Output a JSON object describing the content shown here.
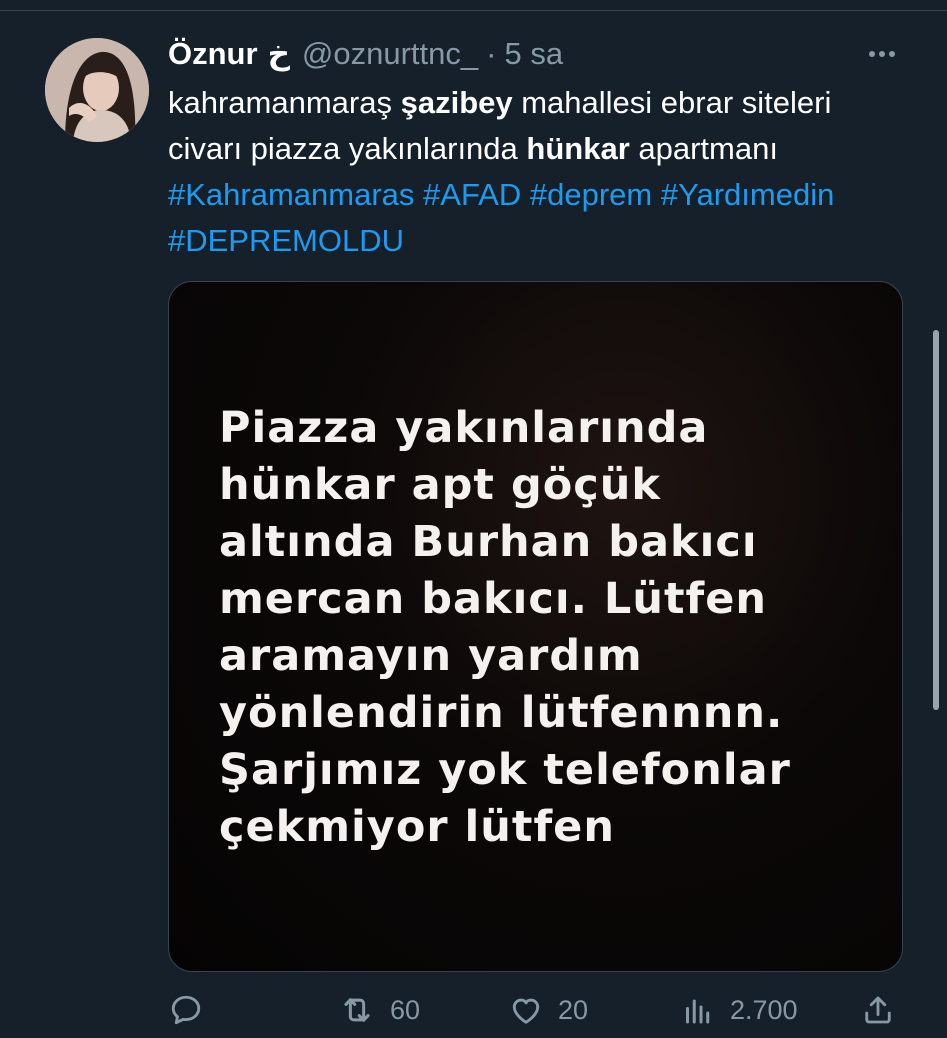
{
  "tweet": {
    "author_name": "Öznur",
    "author_emoji": "خ",
    "handle": "@oznurttnc_",
    "separator": "·",
    "time": "5 sa",
    "text_segments": [
      {
        "text": "kahramanmaraş ",
        "style": "normal"
      },
      {
        "text": "şazibey",
        "style": "bold"
      },
      {
        "text": " mahallesi ebrar siteleri civarı piazza yakınlarında ",
        "style": "normal"
      },
      {
        "text": "hünkar",
        "style": "bold"
      },
      {
        "text": " apartmanı ",
        "style": "normal"
      },
      {
        "text": "#Kahramanmaras",
        "style": "hashtag"
      },
      {
        "text": " ",
        "style": "normal"
      },
      {
        "text": "#AFAD",
        "style": "hashtag"
      },
      {
        "text": " ",
        "style": "normal"
      },
      {
        "text": "#deprem",
        "style": "hashtag"
      },
      {
        "text": " ",
        "style": "normal"
      },
      {
        "text": "#Yardımedin",
        "style": "hashtag"
      },
      {
        "text": " ",
        "style": "normal"
      },
      {
        "text": "#DEPREMOLDU",
        "style": "hashtag"
      }
    ],
    "media_lines": [
      "Piazza yakınlarında",
      "hünkar apt göçük",
      "altında Burhan bakıcı",
      "mercan bakıcı. Lütfen",
      "aramayın yardım",
      "yönlendirin lütfennnn.",
      "Şarjımız yok telefonlar",
      "çekmiyor lütfen"
    ],
    "actions": {
      "reply_count": "",
      "retweet_count": "60",
      "like_count": "20",
      "views_count": "2.700"
    }
  },
  "icons": {
    "more": "more-dots-icon",
    "reply": "reply-bubble-icon",
    "retweet": "retweet-icon",
    "like": "heart-icon",
    "views": "views-bar-chart-icon",
    "share": "share-upload-icon"
  },
  "colors": {
    "background": "#15202b",
    "text": "#ffffff",
    "muted": "#8899a6",
    "hashtag": "#1d9bf0",
    "border": "#38444d"
  }
}
